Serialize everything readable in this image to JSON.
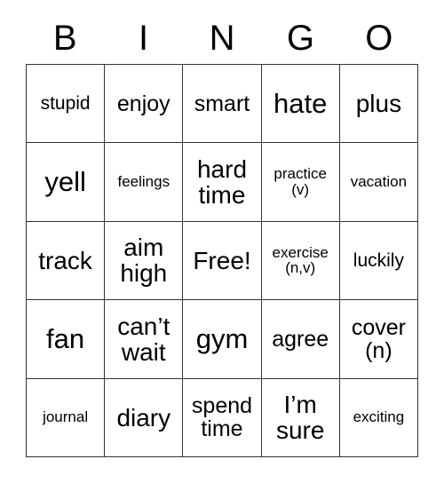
{
  "card": {
    "header_letters": [
      "B",
      "I",
      "N",
      "G",
      "O"
    ],
    "rows": [
      [
        {
          "text": "stupid",
          "size": "sm"
        },
        {
          "text": "enjoy",
          "size": "md"
        },
        {
          "text": "smart",
          "size": "md"
        },
        {
          "text": "hate",
          "size": "xl"
        },
        {
          "text": "plus",
          "size": "lg"
        }
      ],
      [
        {
          "text": "yell",
          "size": "xl"
        },
        {
          "text": "feelings",
          "size": "xs"
        },
        {
          "text": "hard\ntime",
          "size": "lg"
        },
        {
          "text": "practice\n(v)",
          "size": "xs"
        },
        {
          "text": "vacation",
          "size": "xs"
        }
      ],
      [
        {
          "text": "track",
          "size": "lg"
        },
        {
          "text": "aim\nhigh",
          "size": "lg"
        },
        {
          "text": "Free!",
          "size": "lg"
        },
        {
          "text": "exercise\n(n,v)",
          "size": "xs"
        },
        {
          "text": "luckily",
          "size": "sm"
        }
      ],
      [
        {
          "text": "fan",
          "size": "xl"
        },
        {
          "text": "can’t\nwait",
          "size": "lg"
        },
        {
          "text": "gym",
          "size": "xl"
        },
        {
          "text": "agree",
          "size": "md"
        },
        {
          "text": "cover\n(n)",
          "size": "md"
        }
      ],
      [
        {
          "text": "journal",
          "size": "xs"
        },
        {
          "text": "diary",
          "size": "lg"
        },
        {
          "text": "spend\ntime",
          "size": "md"
        },
        {
          "text": "I’m\nsure",
          "size": "lg"
        },
        {
          "text": "exciting",
          "size": "xs"
        }
      ]
    ]
  }
}
